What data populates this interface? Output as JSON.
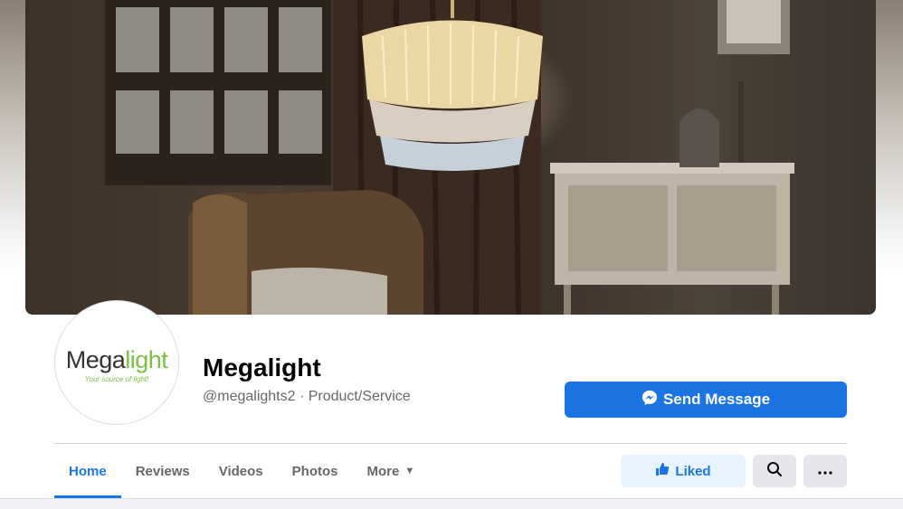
{
  "page": {
    "name": "Megalight",
    "handle_line": "@megalights2 · Product/Service"
  },
  "logo": {
    "word_part1": "Mega",
    "word_part2": "l",
    "word_part3": "ight",
    "tagline": "Your source of light!"
  },
  "actions": {
    "send_message": "Send Message",
    "liked": "Liked"
  },
  "tabs": [
    {
      "label": "Home",
      "active": true
    },
    {
      "label": "Reviews"
    },
    {
      "label": "Videos"
    },
    {
      "label": "Photos"
    },
    {
      "label": "More"
    }
  ],
  "colors": {
    "accent": "#1b74e4",
    "liked_bg": "#e7f3ff",
    "logo_green": "#7ac143"
  },
  "icons": {
    "messenger": "messenger-icon",
    "thumb": "thumbs-up-icon",
    "search": "search-icon",
    "more": "ellipsis-icon",
    "caret": "caret-down-icon"
  }
}
